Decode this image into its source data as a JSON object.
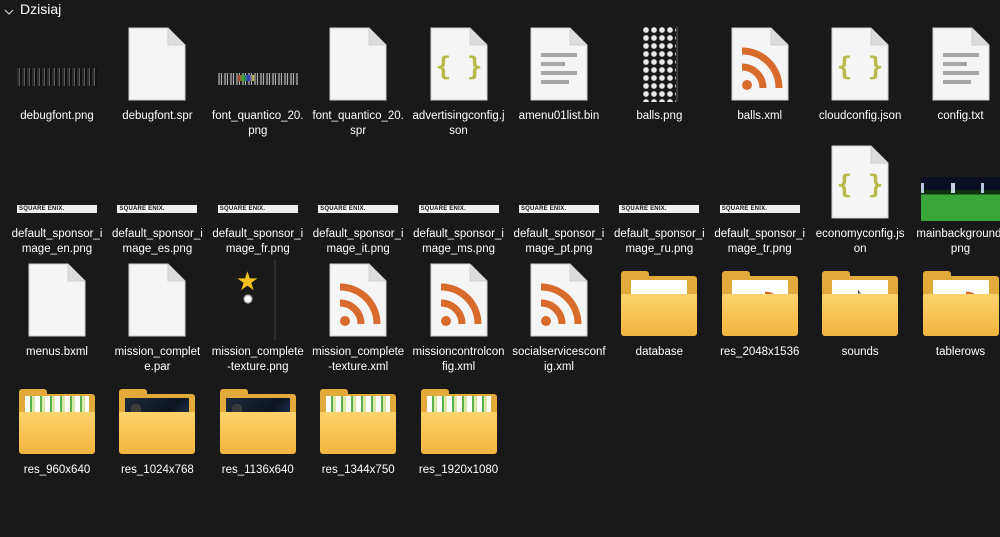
{
  "window": {
    "group_label": "Dzisiaj"
  },
  "colors": {
    "background": "#191919",
    "folder": "#f2b43e",
    "xml_rss": "#d86a2b",
    "json_braces": "#b7b94a"
  },
  "items": [
    {
      "name": "debugfont.png",
      "kind": "strip-dark"
    },
    {
      "name": "debugfont.spr",
      "kind": "blank-doc"
    },
    {
      "name": "font_quantico_20.png",
      "kind": "strip-font"
    },
    {
      "name": "font_quantico_20.spr",
      "kind": "blank-doc"
    },
    {
      "name": "advertisingconfig.json",
      "kind": "json-doc"
    },
    {
      "name": "amenu01list.bin",
      "kind": "lines-doc"
    },
    {
      "name": "balls.png",
      "kind": "balls"
    },
    {
      "name": "balls.xml",
      "kind": "rss-doc"
    },
    {
      "name": "cloudconfig.json",
      "kind": "json-doc"
    },
    {
      "name": "config.txt",
      "kind": "lines-doc"
    },
    {
      "name": "default_sponsor_image_en.png",
      "kind": "sponsor"
    },
    {
      "name": "default_sponsor_image_es.png",
      "kind": "sponsor"
    },
    {
      "name": "default_sponsor_image_fr.png",
      "kind": "sponsor"
    },
    {
      "name": "default_sponsor_image_it.png",
      "kind": "sponsor"
    },
    {
      "name": "default_sponsor_image_ms.png",
      "kind": "sponsor"
    },
    {
      "name": "default_sponsor_image_pt.png",
      "kind": "sponsor"
    },
    {
      "name": "default_sponsor_image_ru.png",
      "kind": "sponsor"
    },
    {
      "name": "default_sponsor_image_tr.png",
      "kind": "sponsor"
    },
    {
      "name": "economyconfig.json",
      "kind": "json-doc"
    },
    {
      "name": "mainbackground.png",
      "kind": "stadium"
    },
    {
      "name": "menus.bxml",
      "kind": "blank-doc"
    },
    {
      "name": "mission_complete.par",
      "kind": "blank-doc"
    },
    {
      "name": "mission_complete-texture.png",
      "kind": "mission-tex"
    },
    {
      "name": "mission_complete-texture.xml",
      "kind": "rss-doc"
    },
    {
      "name": "missioncontrolconfig.xml",
      "kind": "rss-doc"
    },
    {
      "name": "socialservicesconfig.xml",
      "kind": "rss-doc"
    },
    {
      "name": "database",
      "kind": "folder-doc"
    },
    {
      "name": "res_2048x1536",
      "kind": "folder-rss"
    },
    {
      "name": "sounds",
      "kind": "folder-sound"
    },
    {
      "name": "tablerows",
      "kind": "folder-rss"
    },
    {
      "name": "res_960x640",
      "kind": "folder-green"
    },
    {
      "name": "res_1024x768",
      "kind": "folder-photo"
    },
    {
      "name": "res_1136x640",
      "kind": "folder-photo"
    },
    {
      "name": "res_1344x750",
      "kind": "folder-green"
    },
    {
      "name": "res_1920x1080",
      "kind": "folder-green"
    }
  ],
  "sponsor_text": "SQUARE ENIX."
}
